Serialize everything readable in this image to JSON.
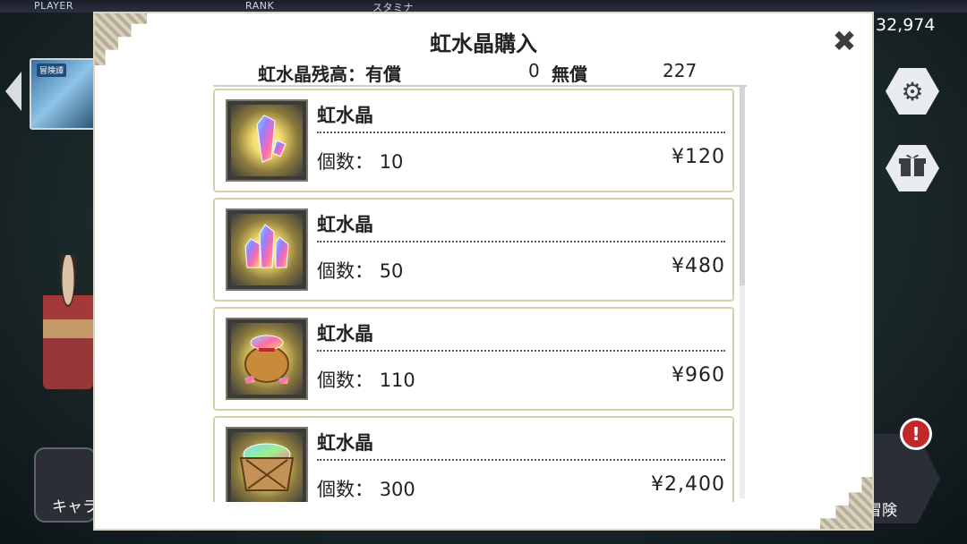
{
  "background": {
    "top_labels": [
      "PLAYER",
      "RANK",
      "スタミナ"
    ],
    "currency": "32,974",
    "chara_label": "キャラ",
    "quest_label": "冒険",
    "banner_badge": "冒険譚",
    "alert_symbol": "!"
  },
  "modal": {
    "title": "虹水晶購入",
    "balance": {
      "label": "虹水晶残高：",
      "paid_label": "有償",
      "paid_value": "0",
      "free_label": "無償",
      "free_value": "227"
    },
    "items": [
      {
        "name": "虹水晶",
        "count_label": "個数：",
        "count": "10",
        "price": "¥120",
        "icon": "crystal-small-icon"
      },
      {
        "name": "虹水晶",
        "count_label": "個数：",
        "count": "50",
        "price": "¥480",
        "icon": "crystal-cluster-icon"
      },
      {
        "name": "虹水晶",
        "count_label": "個数：",
        "count": "110",
        "price": "¥960",
        "icon": "crystal-bag-icon"
      },
      {
        "name": "虹水晶",
        "count_label": "個数：",
        "count": "300",
        "price": "¥2,400",
        "icon": "crystal-crate-icon"
      }
    ]
  },
  "icons": {
    "close": "close-icon",
    "settings": "gear-icon",
    "gift": "gift-icon",
    "alert": "alert-icon"
  },
  "colors": {
    "panel_border": "#d8d0a8",
    "corner_accent": "#b7ae98"
  }
}
